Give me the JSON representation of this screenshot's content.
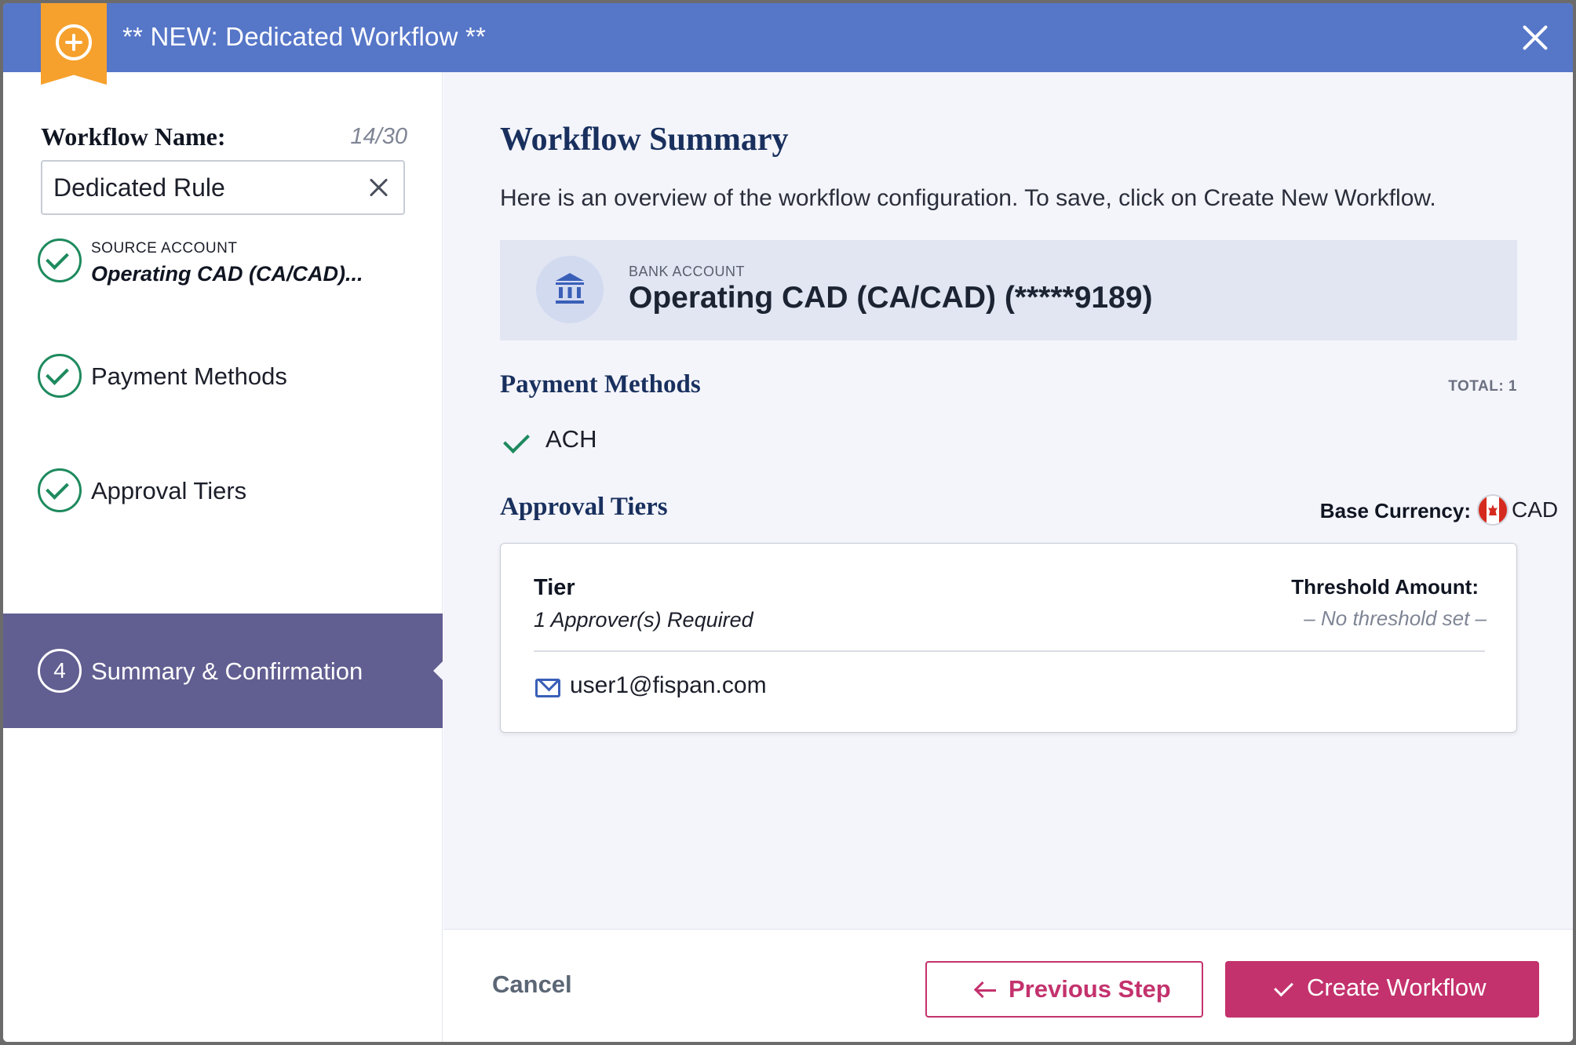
{
  "header": {
    "title": "** NEW: Dedicated Workflow **",
    "badge_icon": "plus-circle-icon",
    "close_icon": "close-icon"
  },
  "sidebar": {
    "name_label": "Workflow Name:",
    "name_count": "14/30",
    "name_value": "Dedicated Rule",
    "steps": [
      {
        "sublabel": "SOURCE ACCOUNT",
        "value": "Operating CAD (CA/CAD)...",
        "status": "complete"
      },
      {
        "label": "Payment Methods",
        "status": "complete"
      },
      {
        "label": "Approval Tiers",
        "status": "complete"
      },
      {
        "number": "4",
        "label": "Summary & Confirmation",
        "status": "active"
      }
    ]
  },
  "main": {
    "title": "Workflow Summary",
    "description": "Here is an overview of the workflow configuration. To save, click on Create New Workflow.",
    "bank": {
      "label": "BANK ACCOUNT",
      "name": "Operating CAD (CA/CAD) (*****9189)",
      "icon": "bank-icon"
    },
    "payment_methods": {
      "title": "Payment Methods",
      "total": "TOTAL: 1",
      "items": [
        "ACH"
      ]
    },
    "approval_tiers": {
      "title": "Approval Tiers",
      "base_currency_label": "Base Currency:",
      "base_currency": "CAD",
      "tier": {
        "title": "Tier",
        "required": "1 Approver(s) Required",
        "threshold_label": "Threshold Amount:",
        "threshold_value": "– No threshold set –",
        "users": [
          "user1@fispan.com"
        ]
      }
    }
  },
  "footer": {
    "cancel": "Cancel",
    "previous": "Previous Step",
    "create": "Create Workflow"
  },
  "colors": {
    "header": "#5676c8",
    "badge": "#f6a12d",
    "active_step": "#615e91",
    "check": "#1e8a5e",
    "primary": "#c3326d",
    "heading": "#19305e"
  }
}
